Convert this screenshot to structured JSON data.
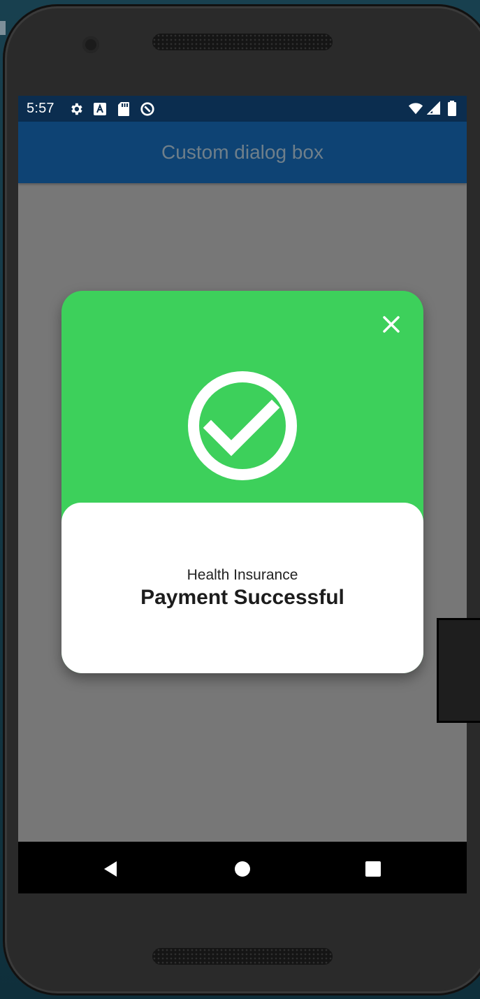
{
  "status_bar": {
    "time": "5:57",
    "left_icons": [
      "settings-icon",
      "font-a-icon",
      "sd-card-icon",
      "at-sign-icon"
    ],
    "right_icons": [
      "wifi-icon",
      "cell-signal-icon",
      "battery-icon"
    ]
  },
  "app_bar": {
    "title": "Custom dialog box"
  },
  "dialog": {
    "close_icon": "close-icon",
    "status_icon": "check-circle-icon",
    "subtitle": "Health Insurance",
    "title": "Payment Successful",
    "colors": {
      "header_green": "#3dd05b",
      "body_white": "#ffffff"
    }
  },
  "navigation": {
    "buttons": [
      "back-icon",
      "home-icon",
      "recents-icon"
    ]
  },
  "colors": {
    "status_bar": "#0b2d4f",
    "app_bar": "#0e4374",
    "scrim": "#777777",
    "nav_bar": "#000000"
  }
}
